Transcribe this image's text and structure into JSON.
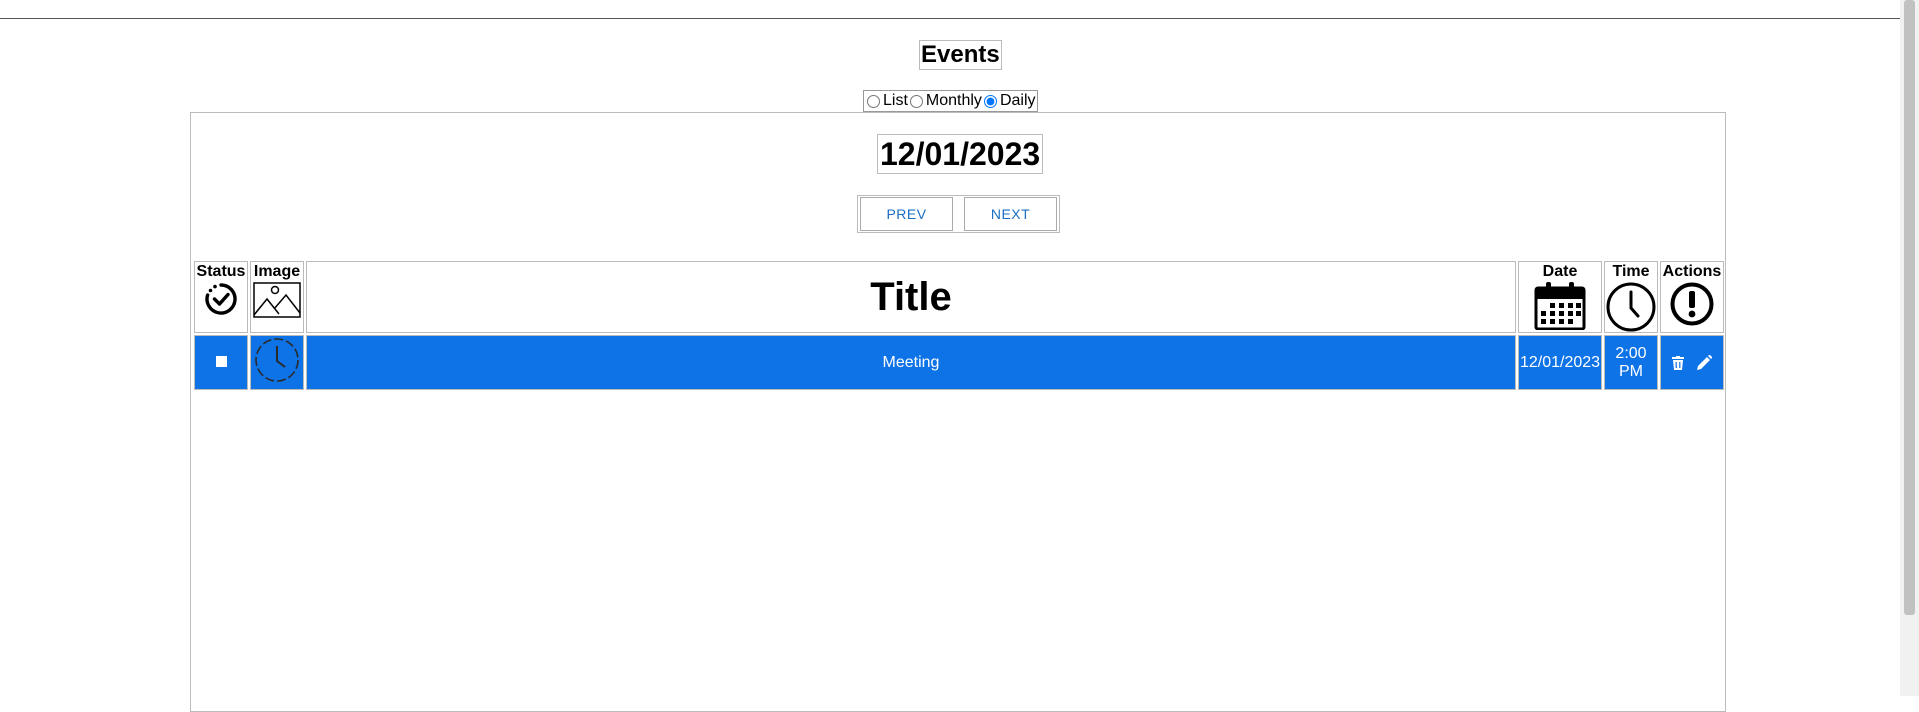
{
  "page": {
    "title": "Events"
  },
  "view_switch": {
    "options": [
      {
        "label": "List",
        "selected": false
      },
      {
        "label": "Monthly",
        "selected": false
      },
      {
        "label": "Daily",
        "selected": true
      }
    ]
  },
  "daily_view": {
    "date": "12/01/2023",
    "prev_label": "PREV",
    "next_label": "NEXT"
  },
  "table": {
    "headers": {
      "status": "Status",
      "image": "Image",
      "title": "Title",
      "date": "Date",
      "time": "Time",
      "actions": "Actions"
    },
    "header_icons": {
      "status": "check-circle-icon",
      "image": "image-icon",
      "date": "calendar-icon",
      "time": "clock-icon",
      "actions": "exclamation-circle-icon"
    },
    "rows": [
      {
        "completed": false,
        "image_icon": "clock-placeholder-icon",
        "title": "Meeting",
        "date": "12/01/2023",
        "time": "2:00 PM",
        "actions": [
          "trash-icon",
          "pencil-icon"
        ]
      }
    ],
    "row_color": "#0d73e6"
  }
}
